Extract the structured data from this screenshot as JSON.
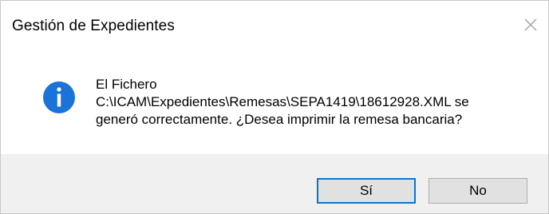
{
  "dialog": {
    "title": "Gestión de Expedientes",
    "close_icon": "close-icon",
    "icon": "info-icon",
    "message_lines": [
      "El Fichero",
      "C:\\ICAM\\Expedientes\\Remesas\\SEPA1419\\18612928.XML se",
      "generó correctamente. ¿Desea imprimir la remesa bancaria?"
    ],
    "buttons": {
      "yes_label": "Sí",
      "no_label": "No"
    }
  },
  "colors": {
    "accent": "#0078d7",
    "info_icon_fill": "#1a73d9",
    "footer_bg": "#f0f0f0"
  }
}
